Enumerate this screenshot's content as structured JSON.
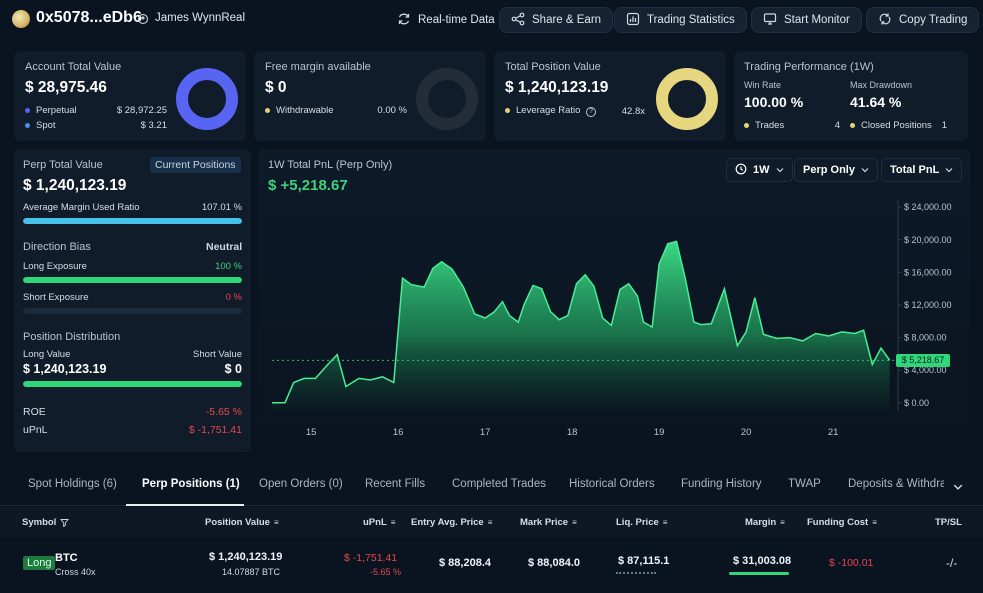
{
  "header": {
    "address": "0x5078...eDb6",
    "user_name": "James WynnReal",
    "buttons": [
      {
        "label": "Real-time Data",
        "icon": "refresh-icon"
      },
      {
        "label": "Share & Earn",
        "icon": "share-icon"
      },
      {
        "label": "Trading Statistics",
        "icon": "stats-icon"
      },
      {
        "label": "Start Monitor",
        "icon": "monitor-icon"
      },
      {
        "label": "Copy Trading",
        "icon": "copy-trading-icon"
      }
    ]
  },
  "cards": {
    "account": {
      "title": "Account Total Value",
      "value": "$ 28,975.46",
      "rows": [
        {
          "label": "Perpetual",
          "value": "$ 28,972.25",
          "color": "#5865f2"
        },
        {
          "label": "Spot",
          "value": "$ 3.21",
          "color": "#4a8ef5"
        }
      ]
    },
    "margin": {
      "title": "Free margin available",
      "value": "$ 0",
      "rows": [
        {
          "label": "Withdrawable",
          "value": "0.00 %",
          "color": "#e6d27a"
        }
      ]
    },
    "position": {
      "title": "Total Position Value",
      "value": "$ 1,240,123.19",
      "rows": [
        {
          "label": "Leverage Ratio",
          "value": "42.8x",
          "color": "#e6d27a"
        }
      ]
    },
    "performance": {
      "title": "Trading Performance (1W)",
      "win_rate_label": "Win Rate",
      "win_rate": "100.00 %",
      "max_dd_label": "Max Drawdown",
      "max_dd": "41.64 %",
      "trades_label": "Trades",
      "trades": "4",
      "closed_label": "Closed Positions",
      "closed": "1"
    }
  },
  "perp": {
    "title": "Perp Total Value",
    "current_positions": "Current Positions",
    "value": "$ 1,240,123.19",
    "avg_margin_label": "Average Margin Used Ratio",
    "avg_margin_value": "107.01 %",
    "avg_margin_fill": 1.0,
    "direction_bias_label": "Direction Bias",
    "direction_bias_value": "Neutral",
    "long_exposure_label": "Long Exposure",
    "long_exposure_value": "100 %",
    "long_exposure_fill": 1.0,
    "short_exposure_label": "Short Exposure",
    "short_exposure_value": "0 %",
    "short_exposure_fill": 0.0,
    "distribution_label": "Position Distribution",
    "long_value_label": "Long Value",
    "short_value_label": "Short Value",
    "long_value": "$ 1,240,123.19",
    "short_value": "$ 0",
    "distribution_fill": 1.0,
    "roe_label": "ROE",
    "roe_value": "-5.65 %",
    "upnl_label": "uPnL",
    "upnl_value": "$ -1,751.41"
  },
  "pnl_chart": {
    "title": "1W Total PnL (Perp Only)",
    "value": "$ +5,218.67",
    "filters": {
      "period": "1W",
      "scope": "Perp Only",
      "metric": "Total PnL"
    },
    "current_label": "$ 5,218.67"
  },
  "chart_data": {
    "type": "area",
    "x_ticks": [
      "15",
      "16",
      "17",
      "18",
      "19",
      "20",
      "21"
    ],
    "y_ticks": [
      "$ 24,000.00",
      "$ 20,000.00",
      "$ 16,000.00",
      "$ 12,000.00",
      "$ 8,000.00",
      "$ 4,000.00",
      "$ 0.00"
    ],
    "ylim": [
      -1000,
      25000
    ],
    "xlim": [
      14.55,
      21.7
    ],
    "x": [
      14.55,
      14.7,
      14.8,
      14.92,
      15.05,
      15.2,
      15.3,
      15.4,
      15.55,
      15.68,
      15.82,
      15.95,
      16.05,
      16.15,
      16.3,
      16.4,
      16.5,
      16.62,
      16.75,
      16.88,
      17.0,
      17.1,
      17.2,
      17.28,
      17.38,
      17.45,
      17.55,
      17.65,
      17.75,
      17.85,
      17.95,
      18.05,
      18.15,
      18.25,
      18.35,
      18.45,
      18.55,
      18.65,
      18.75,
      18.82,
      18.92,
      19.0,
      19.1,
      19.2,
      19.3,
      19.4,
      19.48,
      19.6,
      19.75,
      19.9,
      20.0,
      20.1,
      20.2,
      20.35,
      20.5,
      20.65,
      20.8,
      20.95,
      21.1,
      21.25,
      21.35,
      21.45,
      21.55,
      21.65
    ],
    "y": [
      0,
      0,
      2500,
      3000,
      3000,
      4800,
      5900,
      2000,
      3000,
      2800,
      3200,
      2500,
      15300,
      14500,
      14200,
      16500,
      17300,
      16400,
      14200,
      10900,
      10400,
      11100,
      12400,
      10700,
      9900,
      12100,
      14400,
      14000,
      11200,
      10200,
      10700,
      14600,
      15700,
      14300,
      10400,
      9500,
      13900,
      14600,
      13100,
      9900,
      9300,
      17000,
      19500,
      19800,
      15300,
      9900,
      9600,
      9700,
      14000,
      7000,
      8700,
      12900,
      8400,
      7900,
      8000,
      7600,
      8500,
      8200,
      8700,
      8500,
      8900,
      4700,
      6700,
      5218.67
    ],
    "current_value": 5218.67
  },
  "tabs": [
    "Spot Holdings (6)",
    "Perp Positions (1)",
    "Open Orders (0)",
    "Recent Fills",
    "Completed Trades",
    "Historical Orders",
    "Funding History",
    "TWAP",
    "Deposits & Withdraw"
  ],
  "table": {
    "headers": [
      "Symbol",
      "Position Value",
      "uPnL",
      "Entry Avg. Price",
      "Mark Price",
      "Liq. Price",
      "Margin",
      "Funding Cost",
      "TP/SL"
    ],
    "row": {
      "side": "Long",
      "symbol": "BTC",
      "cross": "Cross 40x",
      "position_value": "$ 1,240,123.19",
      "position_size": "14.07887 BTC",
      "upnl": "$ -1,751.41",
      "upnl_pct": "-5.65 %",
      "entry": "$ 88,208.4",
      "mark": "$ 88,084.0",
      "liq": "$ 87,115.1",
      "margin": "$ 31,003.08",
      "funding": "$ -100.01",
      "tpsl": "-/-"
    }
  }
}
